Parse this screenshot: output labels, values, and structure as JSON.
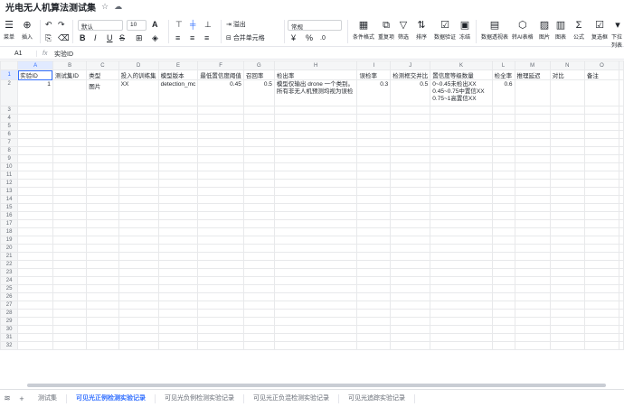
{
  "title": "光电无人机算法测试集",
  "title_icons": [
    "star-icon",
    "cloud-icon"
  ],
  "toolbar": {
    "menu_label": "菜单",
    "insert_label": "插入",
    "font_name": "默认",
    "font_size": "10",
    "wrap_label": "溢出",
    "merge_label": "合并单元格",
    "number_format": "常规",
    "conditional_format": "条件格式",
    "duplicates": "重复项",
    "filter": "筛选",
    "sort": "排序",
    "validation": "数据验证",
    "freeze": "冻结",
    "pivot": "数据透视表",
    "to_ai": "转AI表格",
    "image": "图片",
    "chart": "图表",
    "formula": "公式",
    "checkbox": "复选框",
    "dropdown": "下拉列表"
  },
  "formula_bar": {
    "cell_ref": "A1",
    "fx": "fx",
    "value": "实验ID"
  },
  "columns": [
    "A",
    "B",
    "C",
    "D",
    "E",
    "F",
    "G",
    "H",
    "I",
    "J",
    "K",
    "L",
    "M",
    "N",
    "O"
  ],
  "rows": {
    "header": [
      "实验ID",
      "测试集ID",
      "类型",
      "投入的训练集",
      "模型版本",
      "最低置信度阈值",
      "召回率",
      "检出率",
      "误检率",
      "检测框交并比",
      "置信度等级数量",
      "检全率",
      "推理延迟",
      "对比",
      "备注"
    ],
    "data": [
      "1",
      "",
      "图片",
      "XX",
      "detection_mc",
      "0.45",
      "0.5",
      "模型仅输出 drone 一个类别。所有非无人机预测均视为误检",
      "0.3",
      "0.5",
      "0~0.45未检出XX 0.45~0.75中置信XX 0.75~1高置信XX",
      "0.6",
      "",
      "",
      ""
    ]
  },
  "row_numbers": [
    "1",
    "2",
    "3",
    "4",
    "5",
    "6",
    "7",
    "8",
    "9",
    "10",
    "11",
    "12",
    "13",
    "14",
    "15",
    "16",
    "17",
    "18",
    "19",
    "20",
    "21",
    "22",
    "23",
    "24",
    "25",
    "26",
    "27",
    "28",
    "29",
    "30",
    "31",
    "32"
  ],
  "sheets": [
    "测试集",
    "可见光正例检测实验记录",
    "可见光负例检测实验记录",
    "可见光正负混检测实验记录",
    "可见光追踪实验记录"
  ],
  "active_sheet": "可见光正例检测实验记录",
  "accent_color": "#3370ff"
}
